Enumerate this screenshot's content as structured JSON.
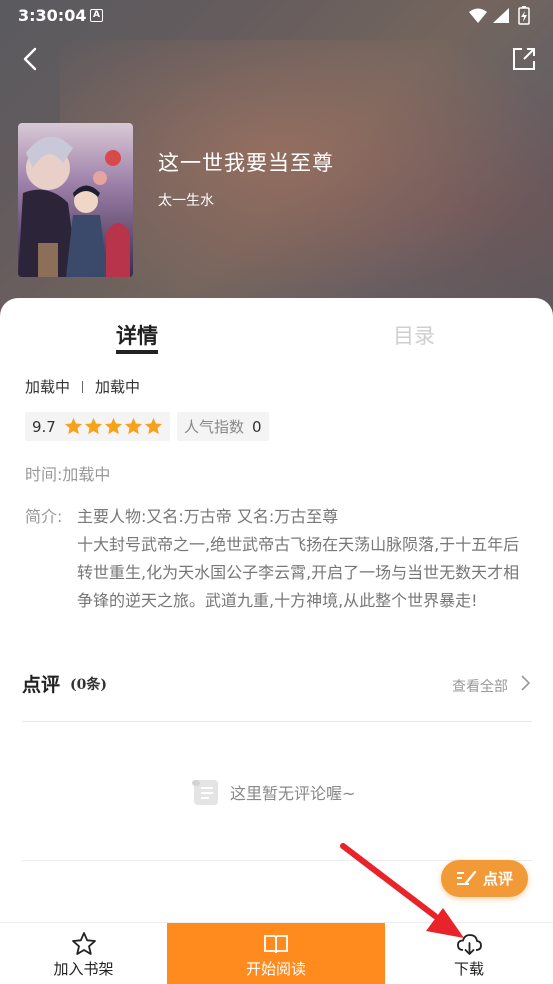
{
  "status_bar": {
    "time": "3:30:04",
    "notification_letter": "A"
  },
  "header": {
    "book_title": "这一世我要当至尊",
    "author": "太一生水"
  },
  "tabs": [
    {
      "label": "详情",
      "active": true
    },
    {
      "label": "目录",
      "active": false
    }
  ],
  "meta": {
    "category": "加载中",
    "status": "加载中"
  },
  "rating": {
    "score": "9.7",
    "stars": 5
  },
  "popularity": {
    "label": "人气指数",
    "value": "0"
  },
  "time": {
    "label": "时间:",
    "value": "加载中"
  },
  "intro": {
    "label": "简介:",
    "text": "主要人物:又名:万古帝 又名:万古至尊\n十大封号武帝之一,绝世武帝古飞扬在天荡山脉陨落,于十五年后转世重生,化为天水国公子李云霄,开启了一场与当世无数天才相争锋的逆天之旅。武道九重,十方神境,从此整个世界暴走!"
  },
  "reviews": {
    "title": "点评",
    "count": "(0条)",
    "view_all": "查看全部",
    "empty_text": "这里暂无评论喔~",
    "write_button": "点评"
  },
  "bottom_bar": {
    "shelf": "加入书架",
    "read": "开始阅读",
    "download": "下载"
  },
  "colors": {
    "accent": "#ff8a1e",
    "fab": "#f39a38",
    "star": "#f7a21b",
    "arrow": "#e8232a"
  }
}
